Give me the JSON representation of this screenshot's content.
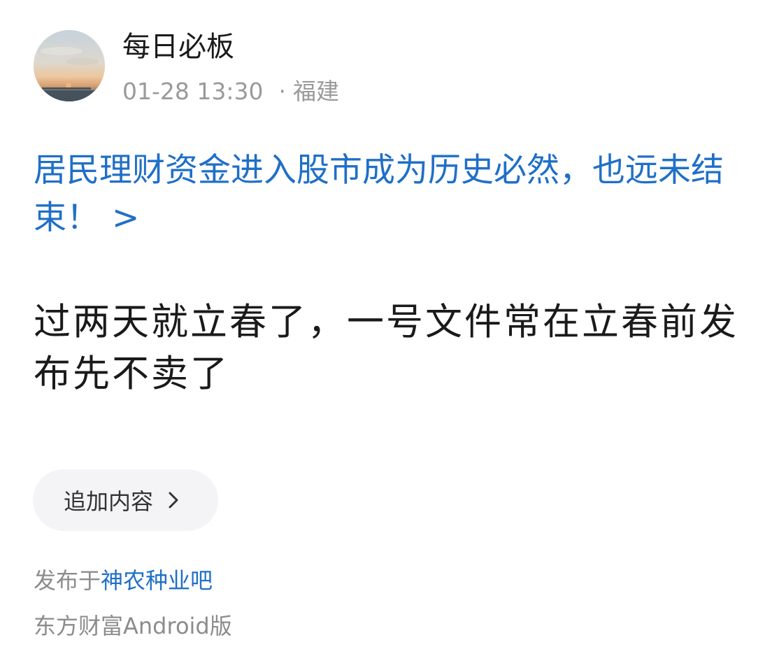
{
  "author": {
    "name": "每日必板",
    "time": "01-28 13:30",
    "separator": "·",
    "location": "福建"
  },
  "title": {
    "text": "居民理财资金进入股市成为历史必然，也远未结束！",
    "chevron": ">"
  },
  "body": {
    "text": "过两天就立春了，一号文件常在立春前发布先不卖了"
  },
  "append_button": {
    "label": "追加内容",
    "icon": "chevron-right-icon"
  },
  "footer": {
    "published_prefix": "发布于",
    "bar_name": "神农种业吧",
    "client": "东方财富Android版"
  },
  "colors": {
    "link": "#1f6fc8",
    "meta": "#9a9a9a",
    "text": "#1a1a1a",
    "button_bg": "#f4f4f6"
  }
}
